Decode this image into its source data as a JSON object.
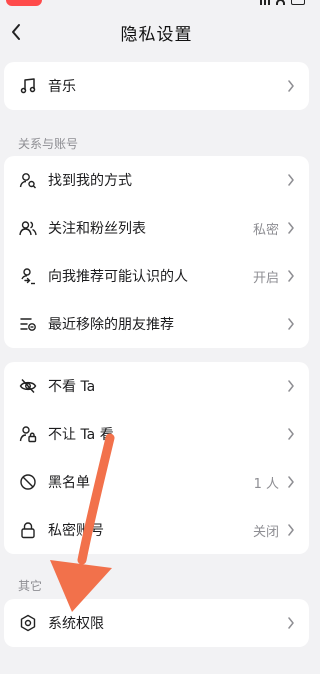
{
  "nav": {
    "title": "隐私设置"
  },
  "card_top": {
    "items": [
      {
        "label": "音乐",
        "icon": "music-note-icon"
      }
    ]
  },
  "section_relations": {
    "title": "关系与账号",
    "items": [
      {
        "label": "找到我的方式",
        "value": "",
        "icon": "user-search-icon"
      },
      {
        "label": "关注和粉丝列表",
        "value": "私密",
        "icon": "users-icon"
      },
      {
        "label": "向我推荐可能认识的人",
        "value": "开启",
        "icon": "user-recommend-icon"
      },
      {
        "label": "最近移除的朋友推荐",
        "value": "",
        "icon": "list-removed-icon"
      }
    ]
  },
  "section_visibility": {
    "items": [
      {
        "label": "不看 Ta",
        "value": "",
        "icon": "eye-off-icon"
      },
      {
        "label": "不让 Ta 看",
        "value": "",
        "icon": "user-lock-icon"
      },
      {
        "label": "黑名单",
        "value": "1 人",
        "icon": "block-icon"
      },
      {
        "label": "私密账号",
        "value": "关闭",
        "icon": "lock-icon"
      }
    ]
  },
  "section_other": {
    "title": "其它",
    "items": [
      {
        "label": "系统权限",
        "value": "",
        "icon": "hexagon-settings-icon"
      }
    ]
  },
  "colors": {
    "background": "#f2f2f4",
    "card": "#ffffff",
    "secondary_text": "#8e8e93",
    "arrow": "#f2714b",
    "status_pill": "#ff4b4b"
  }
}
